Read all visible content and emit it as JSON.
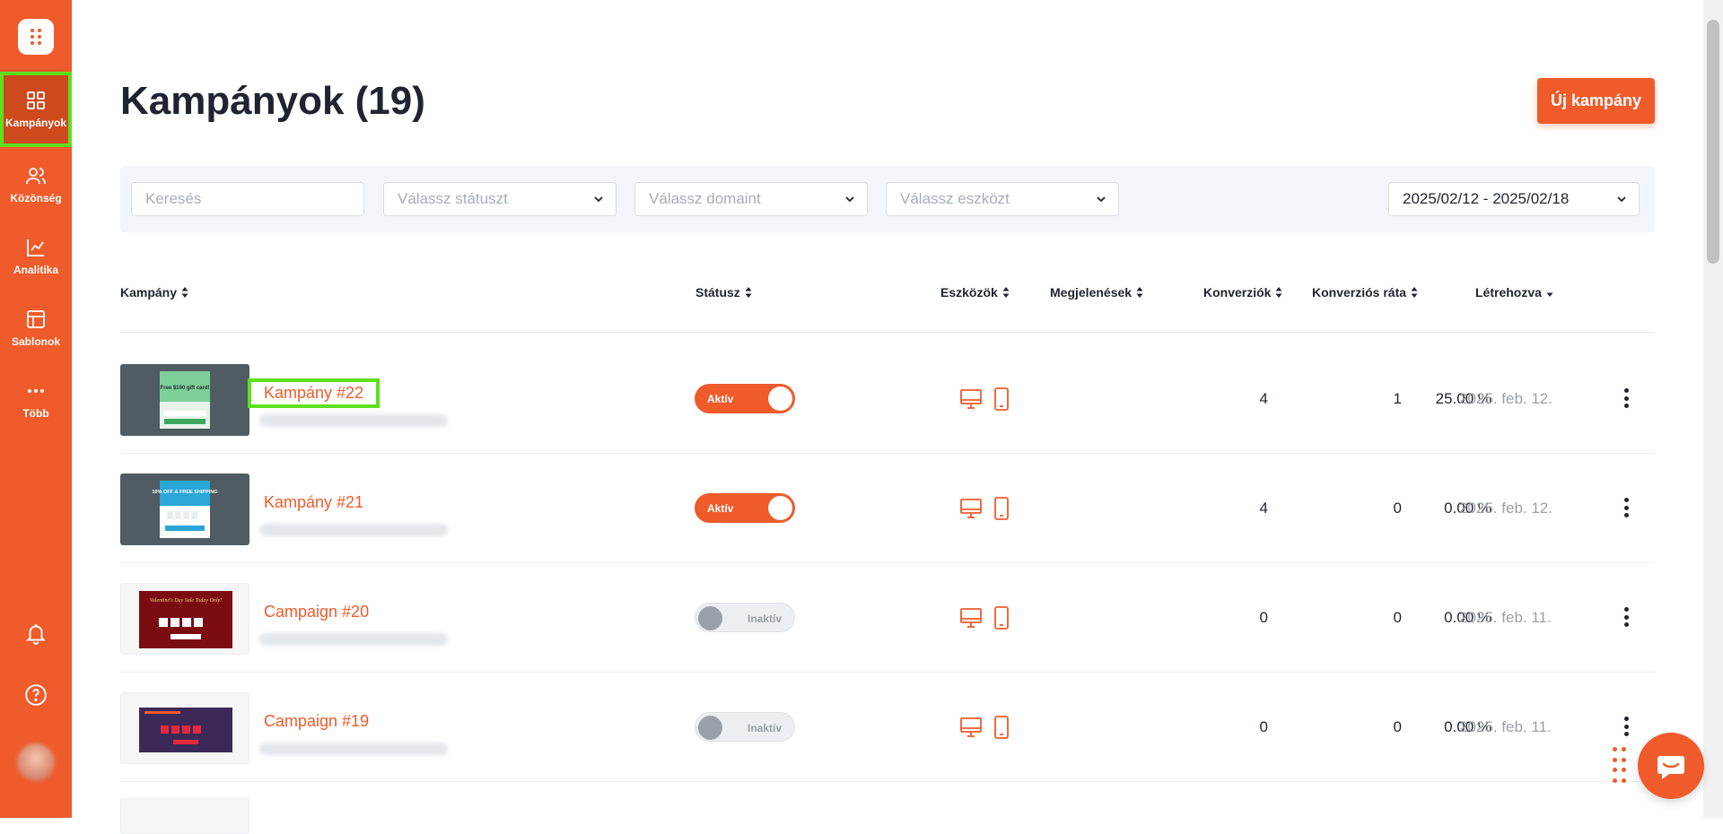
{
  "sidebar": {
    "items": [
      {
        "label": "Kampányok",
        "icon": "grid-icon"
      },
      {
        "label": "Közönség",
        "icon": "users-icon"
      },
      {
        "label": "Analitika",
        "icon": "chart-icon"
      },
      {
        "label": "Sablonok",
        "icon": "layout-icon"
      },
      {
        "label": "Több",
        "icon": "more-icon"
      }
    ],
    "bottom_icons": [
      "bell-icon",
      "help-icon"
    ]
  },
  "header": {
    "title": "Kampányok (19)",
    "new_campaign_label": "Új kampány"
  },
  "filters": {
    "search_placeholder": "Keresés",
    "status_placeholder": "Válassz státuszt",
    "domain_placeholder": "Válassz domaint",
    "device_placeholder": "Válassz eszközt",
    "date_range": "2025/02/12 - 2025/02/18"
  },
  "table": {
    "headers": {
      "campaign": "Kampány",
      "status": "Státusz",
      "devices": "Eszközök",
      "impressions": "Megjelenések",
      "conversions": "Konverziók",
      "conversion_rate": "Konverziós ráta",
      "created": "Létrehozva"
    },
    "rows": [
      {
        "name": "Kampány #22",
        "status": "Aktív",
        "active": true,
        "impressions": "4",
        "conversions": "1",
        "rate": "25.00 %",
        "created": "2025. feb. 12.",
        "thumb_texts": [
          "Free $100 gift card!"
        ]
      },
      {
        "name": "Kampány #21",
        "status": "Aktív",
        "active": true,
        "impressions": "4",
        "conversions": "0",
        "rate": "0.00 %",
        "created": "2025. feb. 12.",
        "thumb_texts": [
          "10% OFF & FREE SHIPPING"
        ]
      },
      {
        "name": "Campaign #20",
        "status": "Inaktív",
        "active": false,
        "impressions": "0",
        "conversions": "0",
        "rate": "0.00 %",
        "created": "2025. feb. 11.",
        "thumb_texts": [
          "Valentine's Day Sale Today Only!"
        ]
      },
      {
        "name": "Campaign #19",
        "status": "Inaktív",
        "active": false,
        "impressions": "0",
        "conversions": "0",
        "rate": "0.00 %",
        "created": "2025. feb. 11.",
        "thumb_texts": []
      }
    ]
  },
  "colors": {
    "brand": "#ef5b2a",
    "highlight": "#5ee01d"
  }
}
